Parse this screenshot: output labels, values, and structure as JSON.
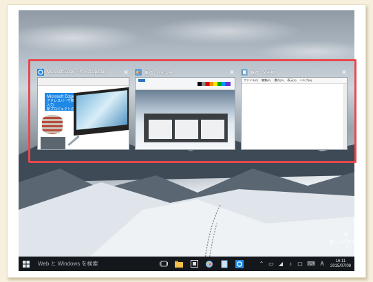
{
  "task_view": {
    "windows": [
      {
        "title": "Microsoft Edge - Project Spartan",
        "edge_promo_title": "Microsoft Edge",
        "edge_promo_body": "アドレスバーで検索・入力\n新プロジェクトの詳細"
      },
      {
        "title": "無題 - ペイント"
      },
      {
        "title": "無題 - メモ帳",
        "menu": [
          "ファイル(F)",
          "編集(E)",
          "書式(O)",
          "表示(V)",
          "ヘルプ(H)"
        ]
      }
    ]
  },
  "new_desktop": {
    "label": "新しいデスクトップ"
  },
  "taskbar": {
    "search_placeholder": "Web と Windows を検索",
    "tray_ime": "A",
    "time": "16:11",
    "date": "2015/07/08"
  },
  "colors": {
    "highlight": "#e8484b",
    "edge_blue": "#1e88e5",
    "taskbar": "#14181c"
  }
}
